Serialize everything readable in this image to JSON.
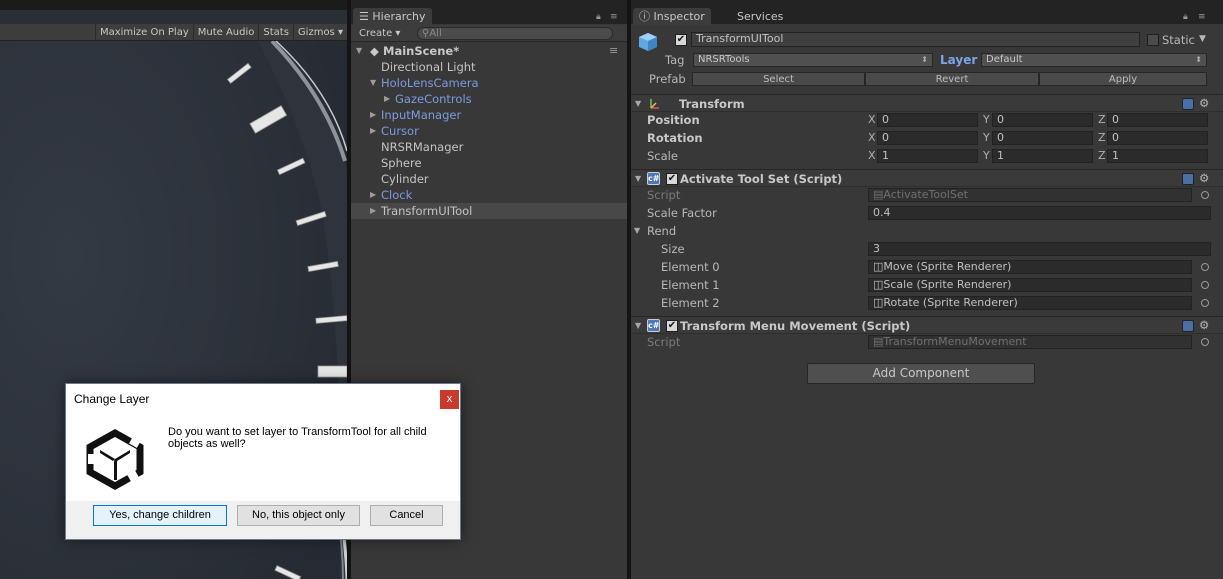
{
  "game": {
    "toolbar": [
      "Maximize On Play",
      "Mute Audio",
      "Stats",
      "Gizmos"
    ],
    "gizmos_arrow": "▾"
  },
  "hierarchy": {
    "tab_label": "Hierarchy",
    "create_label": "Create",
    "search_placeholder": "All",
    "scene_name": "MainScene*",
    "items": [
      {
        "label": "Directional Light",
        "indent": 1,
        "arrow": false,
        "prefab": false,
        "selected": false
      },
      {
        "label": "HoloLensCamera",
        "indent": 1,
        "arrow": true,
        "expanded": true,
        "prefab": true,
        "selected": false
      },
      {
        "label": "GazeControls",
        "indent": 2,
        "arrow": true,
        "prefab": true,
        "selected": false
      },
      {
        "label": "InputManager",
        "indent": 1,
        "arrow": true,
        "prefab": true,
        "selected": false
      },
      {
        "label": "Cursor",
        "indent": 1,
        "arrow": true,
        "prefab": true,
        "selected": false
      },
      {
        "label": "NRSRManager",
        "indent": 1,
        "arrow": false,
        "prefab": false,
        "selected": false
      },
      {
        "label": "Sphere",
        "indent": 1,
        "arrow": false,
        "prefab": false,
        "selected": false
      },
      {
        "label": "Cylinder",
        "indent": 1,
        "arrow": false,
        "prefab": false,
        "selected": false
      },
      {
        "label": "Clock",
        "indent": 1,
        "arrow": true,
        "prefab": true,
        "selected": false
      },
      {
        "label": "TransformUITool",
        "indent": 1,
        "arrow": true,
        "prefab": false,
        "selected": true
      }
    ]
  },
  "inspector": {
    "tabs": [
      "Inspector",
      "Services"
    ],
    "object_name": "TransformUITool",
    "static_label": "Static",
    "tag_label": "Tag",
    "tag_value": "NRSRTools",
    "layer_label": "Layer",
    "layer_value": "Default",
    "prefab_label": "Prefab",
    "prefab_buttons": [
      "Select",
      "Revert",
      "Apply"
    ],
    "transform": {
      "title": "Transform",
      "rows": [
        {
          "label": "Position",
          "bold": true,
          "x": "0",
          "y": "0",
          "z": "0"
        },
        {
          "label": "Rotation",
          "bold": true,
          "x": "0",
          "y": "0",
          "z": "0"
        },
        {
          "label": "Scale",
          "bold": false,
          "x": "1",
          "y": "1",
          "z": "1"
        }
      ]
    },
    "activate_tool_set": {
      "title": "Activate Tool Set (Script)",
      "script_label": "Script",
      "script_value": "ActivateToolSet",
      "scale_factor_label": "Scale Factor",
      "scale_factor_value": "0.4",
      "rend_label": "Rend",
      "size_label": "Size",
      "size_value": "3",
      "elements": [
        {
          "label": "Element 0",
          "value": "Move (Sprite Renderer)"
        },
        {
          "label": "Element 1",
          "value": "Scale (Sprite Renderer)"
        },
        {
          "label": "Element 2",
          "value": "Rotate (Sprite Renderer)"
        }
      ]
    },
    "transform_menu_movement": {
      "title": "Transform Menu Movement (Script)",
      "script_label": "Script",
      "script_value": "TransformMenuMovement"
    },
    "add_component_label": "Add Component"
  },
  "dialog": {
    "title": "Change Layer",
    "close_glyph": "x",
    "message": "Do you want to set layer to TransformTool for all child objects as well?",
    "buttons": [
      "Yes, change children",
      "No, this object only",
      "Cancel"
    ]
  },
  "colors": {
    "prefab_blue": "#7c9be0",
    "layer_label_blue": "#7fa3e8",
    "dialog_close_red": "#c83a2c",
    "dialog_default_border": "#0078d7"
  }
}
